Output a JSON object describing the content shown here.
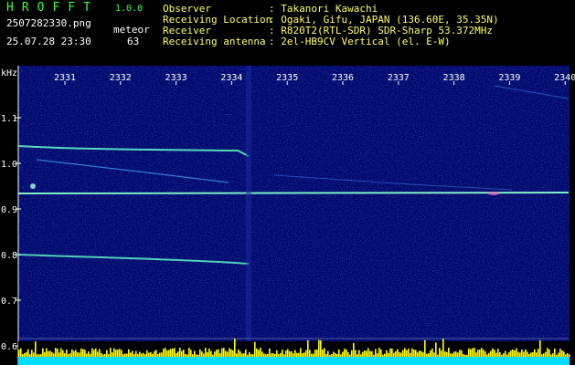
{
  "header": {
    "brand": "HROFFT",
    "version": "1.0.0",
    "filename": "2507282330.png",
    "meteor_label": "meteor",
    "datetime": "25.07.28 23:30",
    "meteor_count": "63",
    "info": [
      {
        "label": "Observer",
        "value": ": Takanori Kawachi"
      },
      {
        "label": "Receiving Location",
        "value": ": Ogaki, Gifu, JAPAN (136.60E, 35.35N)"
      },
      {
        "label": "Receiver",
        "value": ": R820T2(RTL-SDR) SDR-Sharp 53.372MHz"
      },
      {
        "label": "Receiving antenna",
        "value": ": 2el-HB9CV Vertical (el. E-W)"
      }
    ]
  },
  "spectrogram": {
    "y_unit": "kHz",
    "y_ticks": [
      "1.1",
      "1.0",
      "0.9",
      "0.8",
      "0.7",
      "0.6"
    ],
    "x_ticks": [
      "2331",
      "2332",
      "2333",
      "2334",
      "2335",
      "2336",
      "2337",
      "2338",
      "2339",
      "2340"
    ]
  },
  "colors": {
    "background": "#000000",
    "plot_bg": "#000a6e",
    "text_green": "#33ff33",
    "text_white": "#ffffff",
    "text_yellow": "#ffff66",
    "trace": "#66ffcc",
    "signal_bar": "#ffff00",
    "baseline": "#00ddff"
  }
}
